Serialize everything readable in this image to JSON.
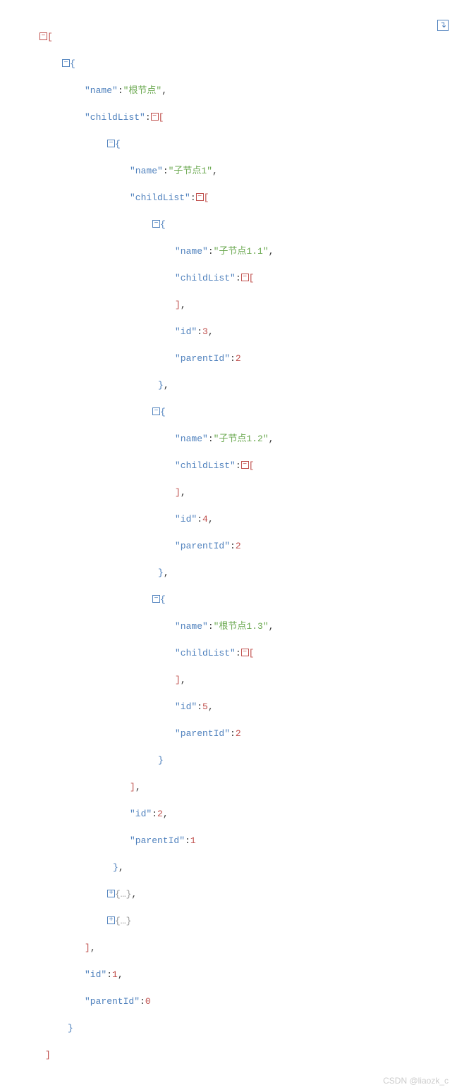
{
  "watermark": "CSDN @liaozk_c",
  "icons": {
    "enter": "→"
  },
  "json": {
    "root": {
      "name_key": "\"name\"",
      "name_val": "\"根节点\"",
      "childList_key": "\"childList\"",
      "id_key": "\"id\"",
      "id_val": "1",
      "parentId_key": "\"parentId\"",
      "parentId_val": "0",
      "children": [
        {
          "name_key": "\"name\"",
          "name_val": "\"子节点1\"",
          "childList_key": "\"childList\"",
          "id_key": "\"id\"",
          "id_val": "2",
          "parentId_key": "\"parentId\"",
          "parentId_val": "1",
          "children": [
            {
              "name_key": "\"name\"",
              "name_val": "\"子节点1.1\"",
              "childList_key": "\"childList\"",
              "id_key": "\"id\"",
              "id_val": "3",
              "parentId_key": "\"parentId\"",
              "parentId_val": "2"
            },
            {
              "name_key": "\"name\"",
              "name_val": "\"子节点1.2\"",
              "childList_key": "\"childList\"",
              "id_key": "\"id\"",
              "id_val": "4",
              "parentId_key": "\"parentId\"",
              "parentId_val": "2"
            },
            {
              "name_key": "\"name\"",
              "name_val": "\"根节点1.3\"",
              "childList_key": "\"childList\"",
              "id_key": "\"id\"",
              "id_val": "5",
              "parentId_key": "\"parentId\"",
              "parentId_val": "2"
            }
          ]
        },
        {
          "collapsed": "{…}"
        },
        {
          "collapsed": "{…}"
        }
      ]
    }
  }
}
